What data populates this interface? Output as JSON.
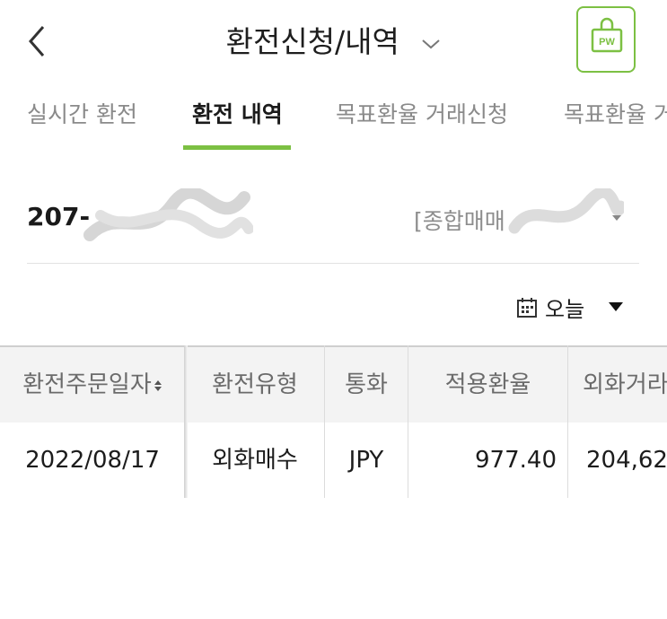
{
  "header": {
    "title": "환전신청/내역",
    "back_icon": "chevron-left-icon",
    "dropdown_icon": "chevron-down-icon",
    "pw_label": "PW",
    "accent_color": "#7cc043"
  },
  "tabs": [
    {
      "label": "실시간 환전",
      "active": false
    },
    {
      "label": "환전 내역",
      "active": true
    },
    {
      "label": "목표환율 거래신청",
      "active": false
    },
    {
      "label": "목표환율 거",
      "active": false
    }
  ],
  "account": {
    "number_prefix": "207-",
    "type_prefix": "[종합매매"
  },
  "filter": {
    "period_label": "오늘"
  },
  "table": {
    "columns": [
      "환전주문일자",
      "환전유형",
      "통화",
      "적용환율",
      "외화거라"
    ],
    "rows": [
      [
        "2022/08/17",
        "외화매수",
        "JPY",
        "977.40",
        "204,62"
      ]
    ]
  }
}
